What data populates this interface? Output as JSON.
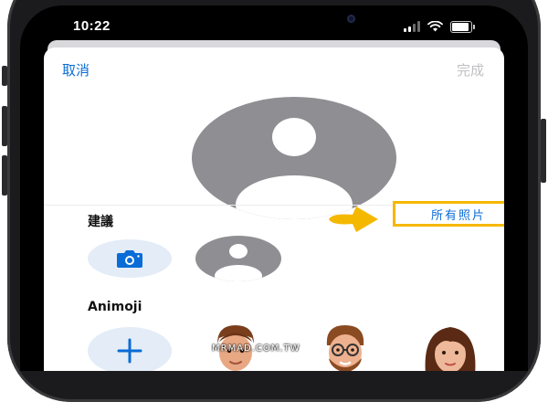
{
  "status_bar": {
    "time": "10:22"
  },
  "nav": {
    "cancel_label": "取消",
    "done_label": "完成"
  },
  "suggestions": {
    "title": "建議",
    "all_photos_label": "所有照片"
  },
  "animoji": {
    "title": "Animoji"
  },
  "watermark": {
    "text": "MRMAD.COM.TW"
  },
  "colors": {
    "accent": "#0a6cd6",
    "highlight": "#f5b800",
    "avatar_gray": "#8e8e93"
  }
}
